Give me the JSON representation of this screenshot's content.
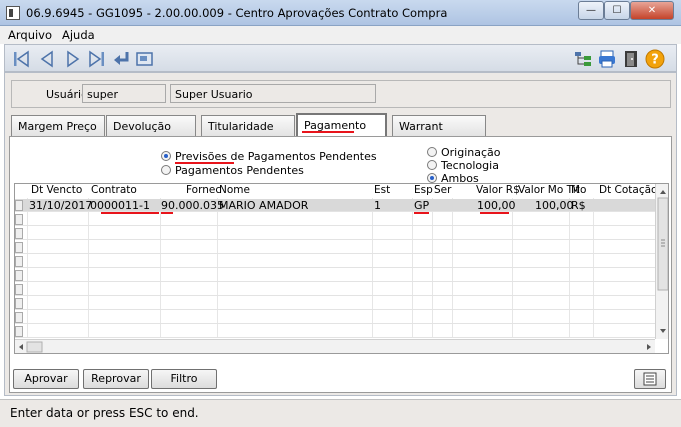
{
  "window": {
    "title": "06.9.6945 - GG1095 - 2.00.00.009 - Centro Aprovações Contrato Compra",
    "min_glyph": "—",
    "max_glyph": "☐",
    "close_glyph": "✕"
  },
  "menu": [
    "Arquivo",
    "Ajuda"
  ],
  "user": {
    "label": "Usuário:",
    "login": "super",
    "name": "Super Usuario"
  },
  "tabs": [
    "Margem Preço",
    "Devolução",
    "Titularidade",
    "Pagamento",
    "Warrant"
  ],
  "active_tab": "Pagamento",
  "options_left": [
    {
      "label": "Previsões de Pagamentos Pendentes",
      "selected": true
    },
    {
      "label": "Pagamentos Pendentes",
      "selected": false
    }
  ],
  "options_right": [
    {
      "label": "Originação",
      "selected": false
    },
    {
      "label": "Tecnologia",
      "selected": false
    },
    {
      "label": "Ambos",
      "selected": true
    }
  ],
  "grid": {
    "columns": [
      "Dt Vencto",
      "Contrato",
      "Fornec",
      "Nome",
      "Est",
      "Esp",
      "Ser",
      "Valor R$",
      "Valor Mo Tit",
      "Mo",
      "Dt Cotação"
    ],
    "rows": [
      [
        "31/10/2017",
        "0000011-1",
        "90.000.035",
        "MARIO AMADOR",
        "1",
        "GP",
        "",
        "100,00",
        "100,00",
        "R$",
        ""
      ]
    ]
  },
  "buttons": {
    "approve": "Aprovar",
    "reject": "Reprovar",
    "filter": "Filtro"
  },
  "status": "Enter data or press ESC to end.",
  "colors": {
    "annotation_red": "#e8141b",
    "accent_blue": "#2860c9"
  }
}
